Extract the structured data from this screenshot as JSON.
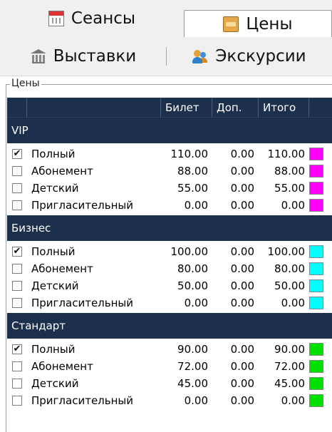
{
  "tabs": {
    "row1": [
      {
        "label": "Сеансы",
        "icon": "calendar-icon",
        "active": false
      },
      {
        "label": "Цены",
        "icon": "price-icon",
        "active": true
      }
    ],
    "row2": [
      {
        "label": "Выставки",
        "icon": "museum-icon",
        "active": false
      },
      {
        "label": "Экскурсии",
        "icon": "tour-icon",
        "active": false
      }
    ]
  },
  "groupbox": {
    "label": "Цены"
  },
  "grid": {
    "columns": [
      "",
      "",
      "Билет",
      "Доп.",
      "Итого",
      ""
    ],
    "sections": [
      {
        "title": "VIP",
        "color": "#ff00ff",
        "rows": [
          {
            "checked": true,
            "name": "Полный",
            "ticket": "110.00",
            "extra": "0.00",
            "total": "110.00"
          },
          {
            "checked": false,
            "name": "Абонемент",
            "ticket": "88.00",
            "extra": "0.00",
            "total": "88.00"
          },
          {
            "checked": false,
            "name": "Детский",
            "ticket": "55.00",
            "extra": "0.00",
            "total": "55.00"
          },
          {
            "checked": false,
            "name": "Пригласительный",
            "ticket": "0.00",
            "extra": "0.00",
            "total": "0.00"
          }
        ]
      },
      {
        "title": "Бизнес",
        "color": "#00ffff",
        "rows": [
          {
            "checked": true,
            "name": "Полный",
            "ticket": "100.00",
            "extra": "0.00",
            "total": "100.00"
          },
          {
            "checked": false,
            "name": "Абонемент",
            "ticket": "80.00",
            "extra": "0.00",
            "total": "80.00"
          },
          {
            "checked": false,
            "name": "Детский",
            "ticket": "50.00",
            "extra": "0.00",
            "total": "50.00"
          },
          {
            "checked": false,
            "name": "Пригласительный",
            "ticket": "0.00",
            "extra": "0.00",
            "total": "0.00"
          }
        ]
      },
      {
        "title": "Стандарт",
        "color": "#00e000",
        "rows": [
          {
            "checked": true,
            "name": "Полный",
            "ticket": "90.00",
            "extra": "0.00",
            "total": "90.00"
          },
          {
            "checked": false,
            "name": "Абонемент",
            "ticket": "72.00",
            "extra": "0.00",
            "total": "72.00"
          },
          {
            "checked": false,
            "name": "Детский",
            "ticket": "45.00",
            "extra": "0.00",
            "total": "45.00"
          },
          {
            "checked": false,
            "name": "Пригласительный",
            "ticket": "0.00",
            "extra": "0.00",
            "total": "0.00"
          }
        ]
      }
    ]
  },
  "checkmark_glyph": "✔"
}
